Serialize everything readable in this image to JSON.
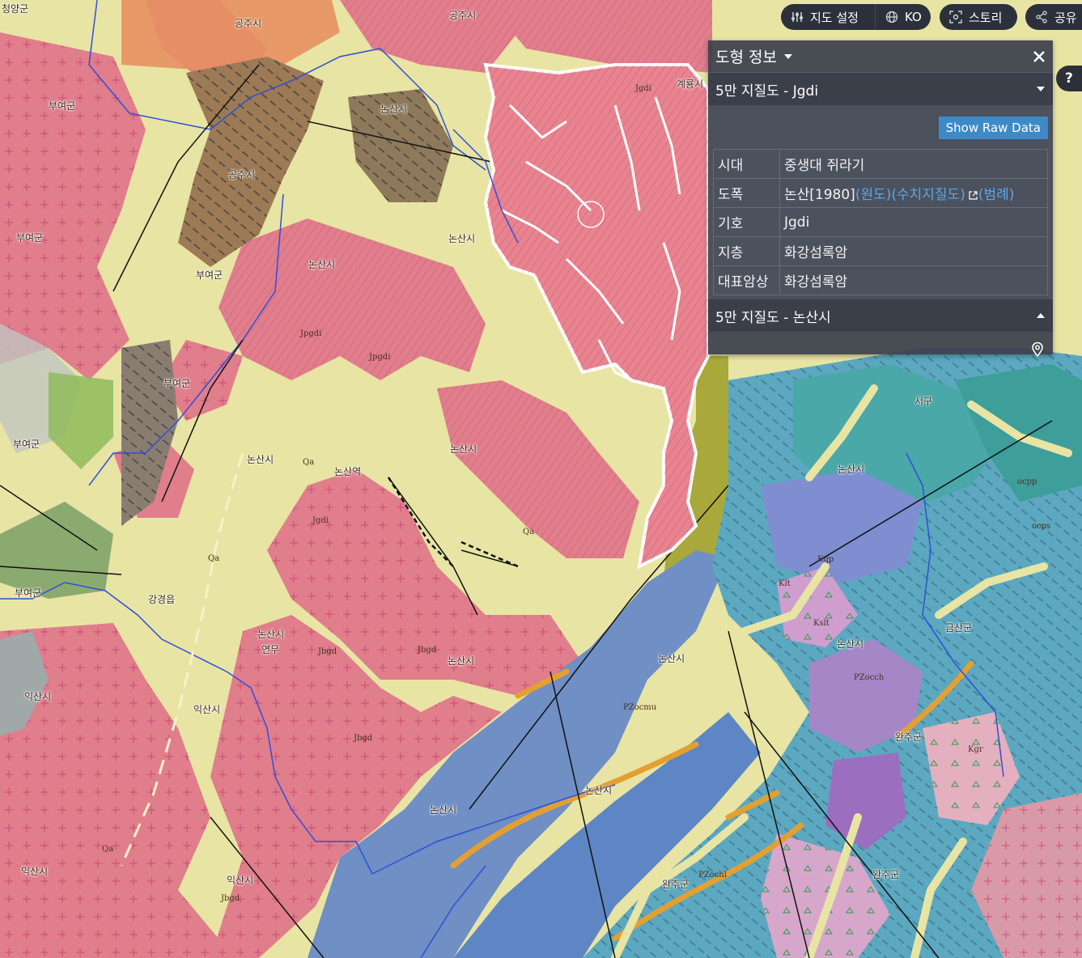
{
  "topbar": {
    "map_settings_label": "지도 설정",
    "language_label": "KO",
    "story_label": "스토리",
    "share_label": "공유"
  },
  "help": {
    "label": "?"
  },
  "panel": {
    "title": "도형 정보",
    "layer_title": "5만 지질도 - Jgdi",
    "raw_button": "Show Raw Data",
    "rows": [
      {
        "key": "시대",
        "value": "중생대 쥐라기"
      },
      {
        "key": "도폭",
        "value": "논산[1980]",
        "links": [
          "(원도)",
          "(수치지질도)",
          "(범례)"
        ]
      },
      {
        "key": "기호",
        "value": "Jgdi"
      },
      {
        "key": "지층",
        "value": "화강섬록암"
      },
      {
        "key": "대표암상",
        "value": "화강섬록암"
      }
    ],
    "second_layer_title": "5만 지질도 - 논산시"
  },
  "map_labels": [
    "청양군",
    "공주시",
    "공주시",
    "부여군",
    "논산시",
    "공주시",
    "부여군",
    "부여군",
    "부여군",
    "부여군",
    "논산시",
    "논산시",
    "논산시",
    "논산시",
    "논산시",
    "논산시",
    "익산시",
    "익산시",
    "익산시",
    "익산시",
    "논산시",
    "완주군",
    "완주군",
    "완주군",
    "금산군",
    "서구",
    "논산시",
    "논산시",
    "논산시",
    "계룡시",
    "논산시",
    "논산역",
    "강경읍",
    "연무",
    "부여군"
  ],
  "unit_labels": [
    "Jgdi",
    "Jpgdi",
    "Jbgd",
    "Qa",
    "PZocmu",
    "PZochl",
    "PZocch",
    "Kslt",
    "Kgr",
    "ocps",
    "ocpp",
    "Jgdi",
    "Jpgdi",
    "Jbgd",
    "Qa",
    "Qa",
    "Qa",
    "Jbgd",
    "Jbgd",
    "Kqp",
    "Klt"
  ]
}
